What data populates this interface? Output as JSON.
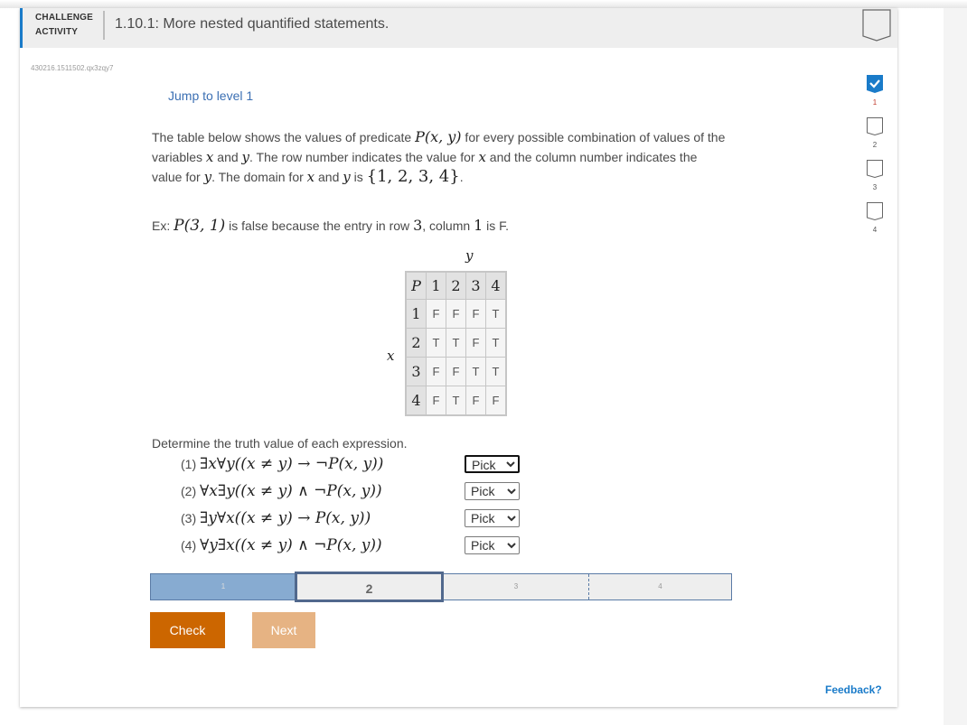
{
  "header": {
    "activity_type_line1": "CHALLENGE",
    "activity_type_line2": "ACTIVITY",
    "title": "1.10.1: More nested quantified statements.",
    "completion_badge": "unchecked-badge-icon"
  },
  "activity_id": "430216.1511502.qx3zqy7",
  "jump_link": "Jump to level 1",
  "level_tracker": [
    {
      "number": "1",
      "status": "completed",
      "icon": "check-badge-icon"
    },
    {
      "number": "2",
      "status": "incomplete",
      "icon": "empty-badge-icon"
    },
    {
      "number": "3",
      "status": "incomplete",
      "icon": "empty-badge-icon"
    },
    {
      "number": "4",
      "status": "incomplete",
      "icon": "empty-badge-icon"
    }
  ],
  "prompt": {
    "p1_a": "The table below shows the values of predicate ",
    "p1_pred": "P(x, y)",
    "p1_b": " for every possible combination of values of the variables ",
    "var_x": "x",
    "and": " and ",
    "var_y": "y",
    "p1_c": ". The row number indicates the value for ",
    "p1_d": " and the column number indicates the value for ",
    "p1_e": ". The domain for ",
    "p1_f": " is ",
    "domain": "{1, 2, 3, 4}",
    "period": "."
  },
  "example": {
    "prefix": "Ex: ",
    "expr": "P(3, 1)",
    "mid": " is false because the entry in row ",
    "row": "3",
    "mid2": ", column ",
    "col": "1",
    "suffix": " is F."
  },
  "table": {
    "row_var": "x",
    "col_var": "y",
    "corner": "P",
    "col_headers": [
      "1",
      "2",
      "3",
      "4"
    ],
    "rows": [
      {
        "header": "1",
        "cells": [
          "F",
          "F",
          "F",
          "T"
        ]
      },
      {
        "header": "2",
        "cells": [
          "T",
          "T",
          "F",
          "T"
        ]
      },
      {
        "header": "3",
        "cells": [
          "F",
          "F",
          "T",
          "T"
        ]
      },
      {
        "header": "4",
        "cells": [
          "F",
          "T",
          "F",
          "F"
        ]
      }
    ]
  },
  "instruction": "Determine the truth value of each expression.",
  "questions": [
    {
      "num": "(1) ",
      "expr": "∃x∀y((x ≠ y) → ¬P(x, y))",
      "select_value": "Pick",
      "focused": true
    },
    {
      "num": "(2) ",
      "expr": "∀x∃y((x ≠ y) ∧ ¬P(x, y))",
      "select_value": "Pick",
      "focused": false
    },
    {
      "num": "(3) ",
      "expr": "∃y∀x((x ≠ y) → P(x, y))",
      "select_value": "Pick",
      "focused": false
    },
    {
      "num": "(4) ",
      "expr": "∀y∃x((x ≠ y) ∧ ¬P(x, y))",
      "select_value": "Pick",
      "focused": false
    }
  ],
  "progress": {
    "segments": [
      "1",
      "2",
      "3",
      "4"
    ],
    "completed": 1,
    "current": 2
  },
  "buttons": {
    "check": "Check",
    "next": "Next"
  },
  "feedback_link": "Feedback?",
  "colors": {
    "accent_blue": "#1a7bc9",
    "check_button": "#cc6600",
    "next_button_disabled": "#e6b383",
    "progress_complete": "#87abd1",
    "progress_current_border": "#51688d"
  }
}
